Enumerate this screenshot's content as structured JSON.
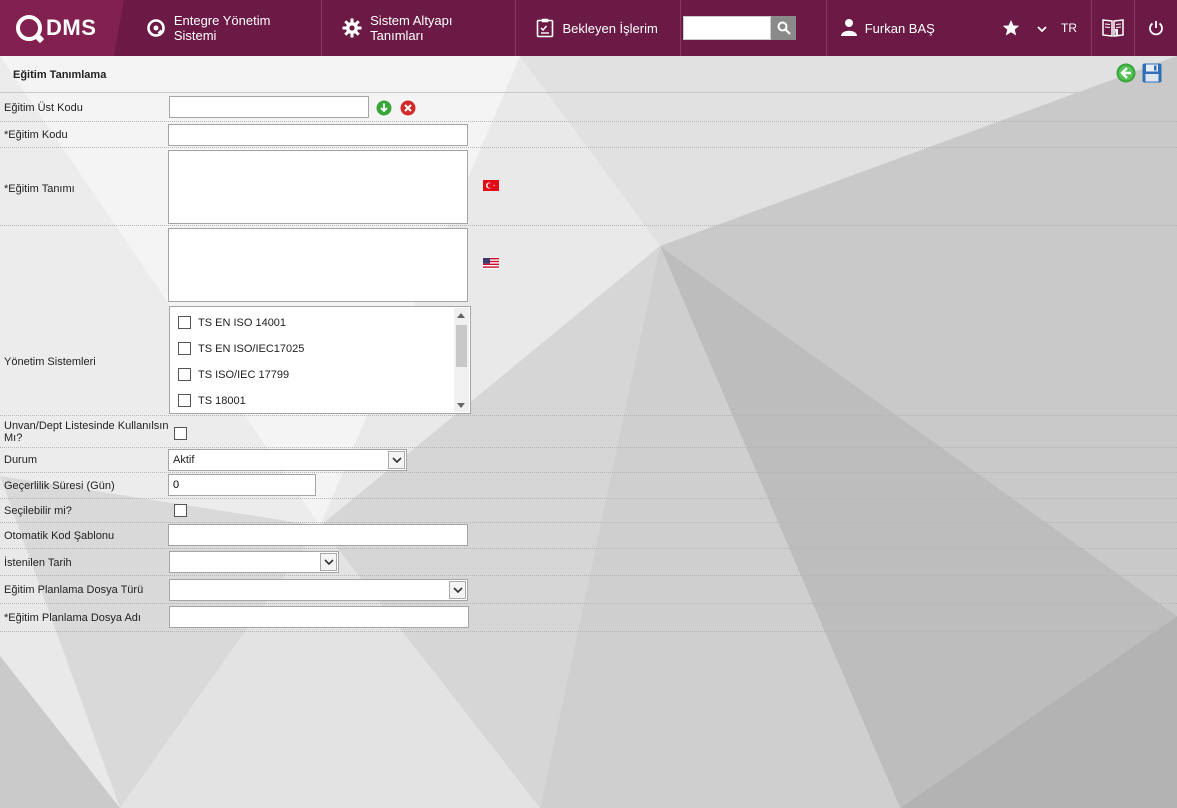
{
  "brand": {
    "logo_text": "DMS"
  },
  "nav": {
    "items": [
      {
        "label": "Entegre Yönetim Sistemi",
        "icon": "qdms-circle-icon"
      },
      {
        "label": "Sistem Altyapı Tanımları",
        "icon": "gear-icon"
      },
      {
        "label": "Bekleyen İşlerim",
        "icon": "clipboard-icon"
      }
    ],
    "search": {
      "value": "",
      "placeholder": ""
    },
    "user_name": "Furkan BAŞ",
    "language": "TR"
  },
  "page": {
    "title": "Eğitim Tanımlama"
  },
  "form": {
    "ust_kodu": {
      "label": "Eğitim Üst Kodu",
      "value": ""
    },
    "kodu": {
      "label": "*Eğitim Kodu",
      "value": ""
    },
    "tanimi": {
      "label": "*Eğitim Tanımı",
      "value_tr": "",
      "value_en": ""
    },
    "yonetim_sistemleri": {
      "label": "Yönetim Sistemleri",
      "options": [
        "TS EN ISO 14001",
        "TS EN ISO/IEC17025",
        "TS ISO/IEC 17799",
        "TS 18001"
      ]
    },
    "unvan_dept": {
      "label_line1": "Unvan/Dept Listesinde Kullanılsın",
      "label_line2": "Mı?"
    },
    "durum": {
      "label": "Durum",
      "value": "Aktif"
    },
    "gecerlilik": {
      "label": "Geçerlilik Süresi (Gün)",
      "value": "0"
    },
    "secilebilir": {
      "label": "Seçilebilir mi?"
    },
    "otomatik_kod": {
      "label": "Otomatik Kod Şablonu",
      "value": ""
    },
    "istenilen_tarih": {
      "label": "İstenilen Tarih",
      "value": ""
    },
    "dosya_turu": {
      "label": "Eğitim Planlama Dosya Türü",
      "value": ""
    },
    "dosya_adi": {
      "label": "*Eğitim Planlama Dosya Adı",
      "value": ""
    }
  },
  "colors": {
    "header_bg": "#6a1a45",
    "logo_bg": "#82204f",
    "accent_green": "#3aa53a",
    "accent_red": "#d02a2a"
  }
}
